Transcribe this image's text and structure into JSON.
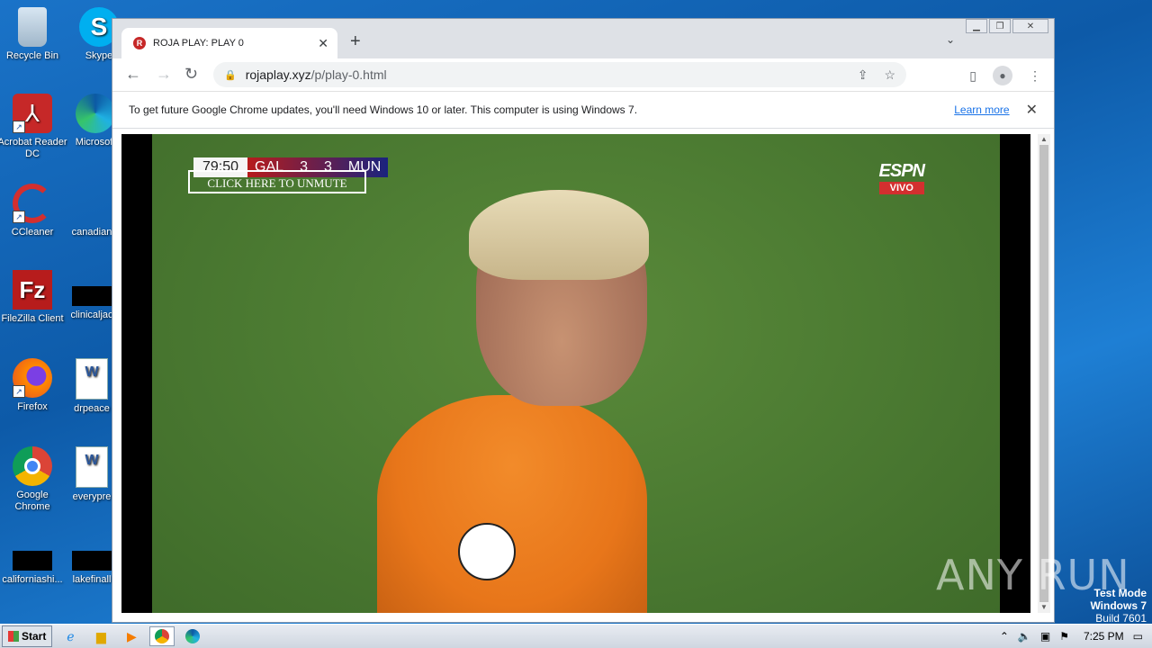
{
  "desktop": {
    "icons": [
      {
        "label": "Recycle Bin"
      },
      {
        "label": "Skype"
      },
      {
        "label": "Acrobat Reader DC"
      },
      {
        "label": "Microsoft"
      },
      {
        "label": "CCleaner"
      },
      {
        "label": "canadian"
      },
      {
        "label": "FileZilla Client"
      },
      {
        "label": "clinicaljac"
      },
      {
        "label": "Firefox"
      },
      {
        "label": "drpeace"
      },
      {
        "label": "Google Chrome"
      },
      {
        "label": "everypre"
      },
      {
        "label": "californiashi..."
      },
      {
        "label": "lakefinall"
      }
    ],
    "watermark": {
      "line1": "Test Mode",
      "line2": "Windows 7",
      "line3": "Build 7601"
    },
    "anyrun": "ANY RUN"
  },
  "browser": {
    "tab_title": "ROJA PLAY: PLAY 0",
    "tab_favicon": "R",
    "url_host": "rojaplay.xyz",
    "url_path": "/p/play-0.html",
    "infobar": {
      "message": "To get future Google Chrome updates, you'll need Windows 10 or later. This computer is using Windows 7.",
      "link": "Learn more"
    }
  },
  "video": {
    "scorebug": {
      "time": "79:50",
      "home": "GAL",
      "home_score": "3",
      "away_score": "3",
      "away": "MUN"
    },
    "unmute_label": "CLICK HERE TO UNMUTE",
    "channel": "ESPN",
    "live_label": "VIVO"
  },
  "taskbar": {
    "start_label": "Start",
    "clock": "7:25 PM"
  }
}
